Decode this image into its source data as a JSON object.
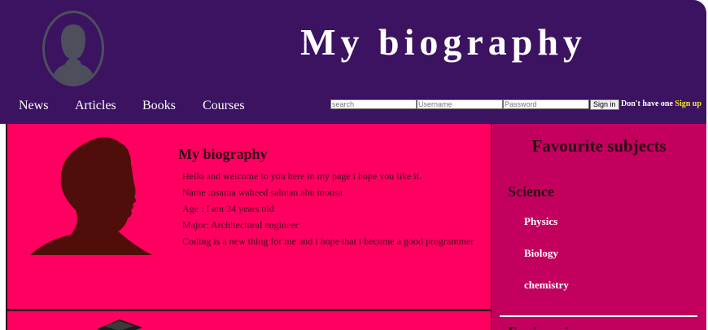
{
  "header": {
    "title": "My biography",
    "nav": [
      "News",
      "Articles",
      "Books",
      "Courses"
    ]
  },
  "auth": {
    "search_placeholder": "search",
    "username_placeholder": "Username",
    "password_placeholder": "Password",
    "signin_label": "Sign in",
    "no_account_text": "Don't have one",
    "signup_label": "Sign up"
  },
  "bio": {
    "heading": "My biography",
    "lines": [
      "Hello and welcome to you here in my page i hope you like it.",
      "Name :osama waheed salman abu mousa",
      "Age : I am 24 years old",
      "Major: Architectural engineer",
      "Coding is a new thing for me and i hope that i become a good programmer"
    ]
  },
  "sidebar": {
    "title": "Favourite subjects",
    "science_heading": "Science",
    "subjects": [
      "Physics",
      "Biology",
      "chemistry"
    ],
    "next_heading": "Engineering"
  },
  "colors": {
    "header_bg": "#3b1361",
    "bio_bg": "#ff0060",
    "sidebar_bg": "#c4005e",
    "signup_accent": "#f2e62a"
  },
  "icons": [
    "user-avatar-icon",
    "person-silhouette-icon",
    "graduation-cap-icon"
  ]
}
